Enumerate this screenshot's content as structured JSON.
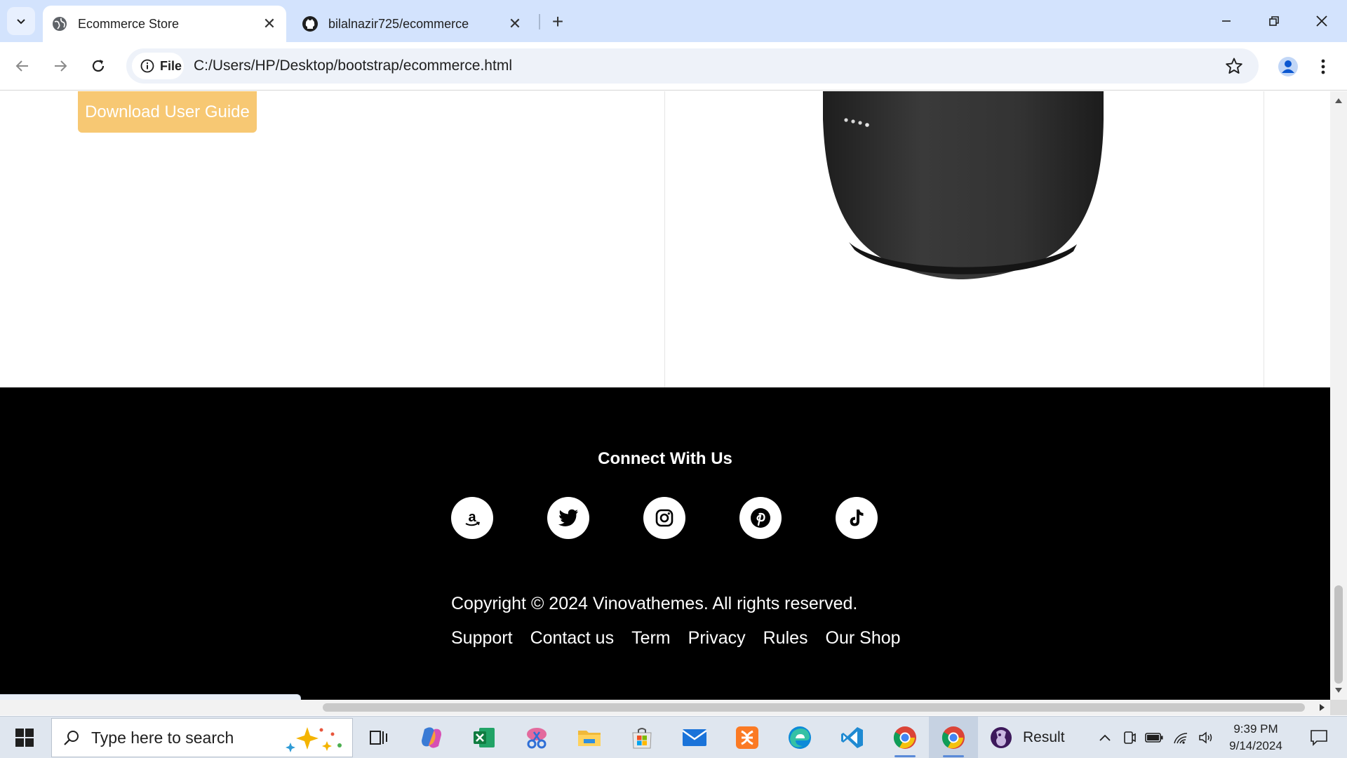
{
  "browser": {
    "tabs": [
      {
        "title": "Ecommerce Store",
        "active": true
      },
      {
        "title": "bilalnazir725/ecommerce",
        "active": false
      }
    ],
    "address": {
      "chip_label": "File",
      "url": "C:/Users/HP/Desktop/bootstrap/ecommerce.html"
    },
    "status_url": "file:///C:/Users/HP/Desktop/bootstrap/ecommerce.html"
  },
  "page": {
    "guide_button": "Download User Guide",
    "footer": {
      "title": "Connect With Us",
      "socials": [
        "amazon-icon",
        "twitter-icon",
        "instagram-icon",
        "pinterest-icon",
        "tiktok-icon"
      ],
      "copyright": "Copyright © 2024 Vinovathemes. All rights reserved.",
      "links": [
        "Support",
        "Contact us",
        "Term",
        "Privacy",
        "Rules",
        "Our Shop"
      ]
    }
  },
  "taskbar": {
    "search_placeholder": "Type here to search",
    "result_label": "Result",
    "time": "9:39 PM",
    "date": "9/14/2024"
  },
  "colors": {
    "tabstrip": "#d3e3fd",
    "guide_button": "#f7c873",
    "footer_bg": "#000000"
  }
}
